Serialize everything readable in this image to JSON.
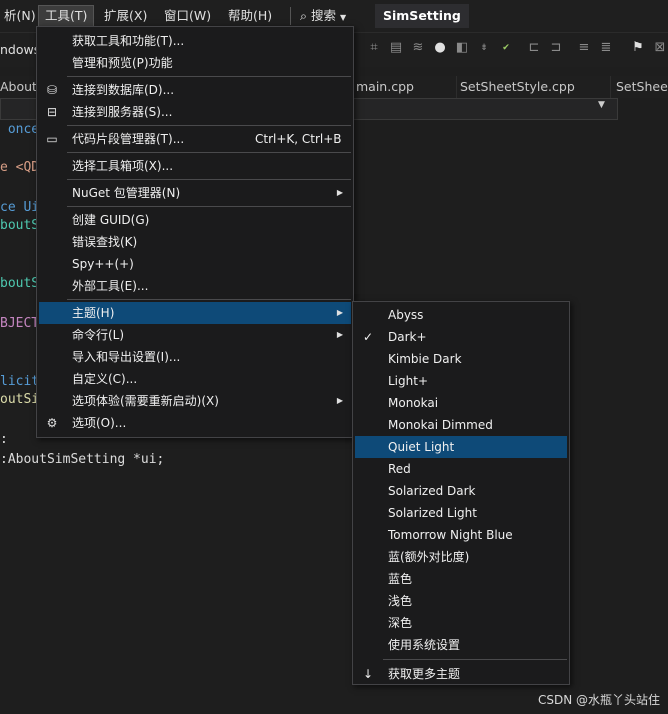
{
  "menubar": {
    "items": [
      "析(N)",
      "工具(T)",
      "扩展(X)",
      "窗口(W)",
      "帮助(H)"
    ],
    "search_label": "搜索",
    "app_title": "SimSetting"
  },
  "toolbar": {
    "left_label": "ndows"
  },
  "tabs": [
    "AboutS",
    "main.cpp",
    "SetSheetStyle.cpp",
    "SetSheet"
  ],
  "code": [
    " once",
    "e <QD",
    "",
    "ce Ui",
    "boutS",
    "",
    "",
    "boutS",
    "",
    "BJECT",
    "",
    "",
    "licit",
    "outSi",
    "",
    "",
    ":AboutSimSetting *ui;"
  ],
  "tools_menu": {
    "items": [
      {
        "label": "获取工具和功能(T)...",
        "shortcut": "",
        "icon": "",
        "submenu": false
      },
      {
        "label": "管理和预览(P)功能",
        "shortcut": "",
        "icon": "",
        "submenu": false
      },
      {
        "sep": true
      },
      {
        "label": "连接到数据库(D)...",
        "shortcut": "",
        "icon": "db-connect-icon",
        "submenu": false
      },
      {
        "label": "连接到服务器(S)...",
        "shortcut": "",
        "icon": "server-connect-icon",
        "submenu": false
      },
      {
        "sep": true
      },
      {
        "label": "代码片段管理器(T)...",
        "shortcut": "Ctrl+K, Ctrl+B",
        "icon": "snippet-icon",
        "submenu": false
      },
      {
        "sep": true
      },
      {
        "label": "选择工具箱项(X)...",
        "shortcut": "",
        "icon": "",
        "submenu": false
      },
      {
        "sep": true
      },
      {
        "label": "NuGet 包管理器(N)",
        "shortcut": "",
        "icon": "",
        "submenu": true
      },
      {
        "sep": true
      },
      {
        "label": "创建 GUID(G)",
        "shortcut": "",
        "icon": "",
        "submenu": false
      },
      {
        "label": "错误查找(K)",
        "shortcut": "",
        "icon": "",
        "submenu": false
      },
      {
        "label": "Spy++(+)",
        "shortcut": "",
        "icon": "",
        "submenu": false
      },
      {
        "label": "外部工具(E)...",
        "shortcut": "",
        "icon": "",
        "submenu": false
      },
      {
        "sep": true
      },
      {
        "label": "主题(H)",
        "shortcut": "",
        "icon": "",
        "submenu": true,
        "highlighted": true
      },
      {
        "label": "命令行(L)",
        "shortcut": "",
        "icon": "",
        "submenu": true
      },
      {
        "label": "导入和导出设置(I)...",
        "shortcut": "",
        "icon": "",
        "submenu": false
      },
      {
        "label": "自定义(C)...",
        "shortcut": "",
        "icon": "",
        "submenu": false
      },
      {
        "label": "选项体验(需要重新启动)(X)",
        "shortcut": "",
        "icon": "",
        "submenu": true
      },
      {
        "label": "选项(O)...",
        "shortcut": "",
        "icon": "gear-icon",
        "submenu": false
      }
    ]
  },
  "theme_menu": {
    "items": [
      "Abyss",
      "Dark+",
      "Kimbie Dark",
      "Light+",
      "Monokai",
      "Monokai Dimmed",
      "Quiet Light",
      "Red",
      "Solarized Dark",
      "Solarized Light",
      "Tomorrow Night Blue",
      "蓝(额外对比度)",
      "蓝色",
      "浅色",
      "深色",
      "使用系统设置"
    ],
    "checked_index": 1,
    "highlighted_index": 6,
    "more_label": "获取更多主题"
  },
  "watermark": "CSDN @水瓶丫头站住",
  "colors": {
    "highlight": "#0e4a78",
    "menu_bg": "#1b1b1c",
    "editor_bg": "#1e1e1e"
  }
}
